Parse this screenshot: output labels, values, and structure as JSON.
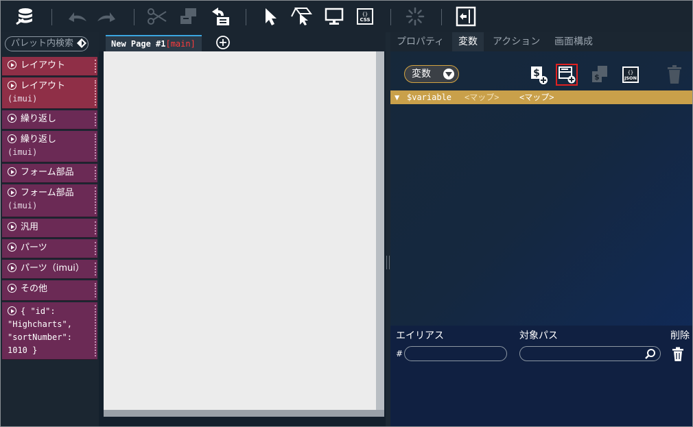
{
  "toolbar": {
    "icons": [
      "database-icon",
      "undo-icon",
      "redo-icon",
      "cut-icon",
      "copy-icon",
      "paste-icon",
      "pointer-icon",
      "select-area-icon",
      "monitor-icon",
      "css-icon",
      "loading-icon",
      "exit-panel-icon"
    ],
    "css_label": "CSS"
  },
  "palette": {
    "search_placeholder": "パレット内検索",
    "items": [
      {
        "label": "レイアウト",
        "sub": ""
      },
      {
        "label": "レイアウト",
        "sub": "(imui)"
      },
      {
        "label": "繰り返し",
        "sub": ""
      },
      {
        "label": "繰り返し",
        "sub": "(imui)"
      },
      {
        "label": "フォーム部品",
        "sub": ""
      },
      {
        "label": "フォーム部品",
        "sub": "(imui)"
      },
      {
        "label": "汎用",
        "sub": ""
      },
      {
        "label": "パーツ",
        "sub": ""
      },
      {
        "label": "パーツ（imui）",
        "sub": ""
      },
      {
        "label": "その他",
        "sub": ""
      }
    ],
    "json_item": {
      "line1": "{ \"id\":",
      "line2": "\"Highcharts\",",
      "line3": "\"sortNumber\":",
      "line4": "1010 }"
    }
  },
  "canvas": {
    "tab_title": "New Page #1",
    "tab_branch": "[main]"
  },
  "right_panel": {
    "tabs": [
      "プロパティ",
      "変数",
      "アクション",
      "画面構成"
    ],
    "active_tab": "変数",
    "var_type": "変数",
    "json_label": "JSON",
    "variable": {
      "name": "$variable",
      "type": "<マップ>",
      "value": "<マップ>"
    },
    "bottom": {
      "alias_label": "エイリアス",
      "path_label": "対象パス",
      "delete_label": "削除",
      "hash": "#",
      "alias_value": "",
      "path_value": ""
    }
  }
}
